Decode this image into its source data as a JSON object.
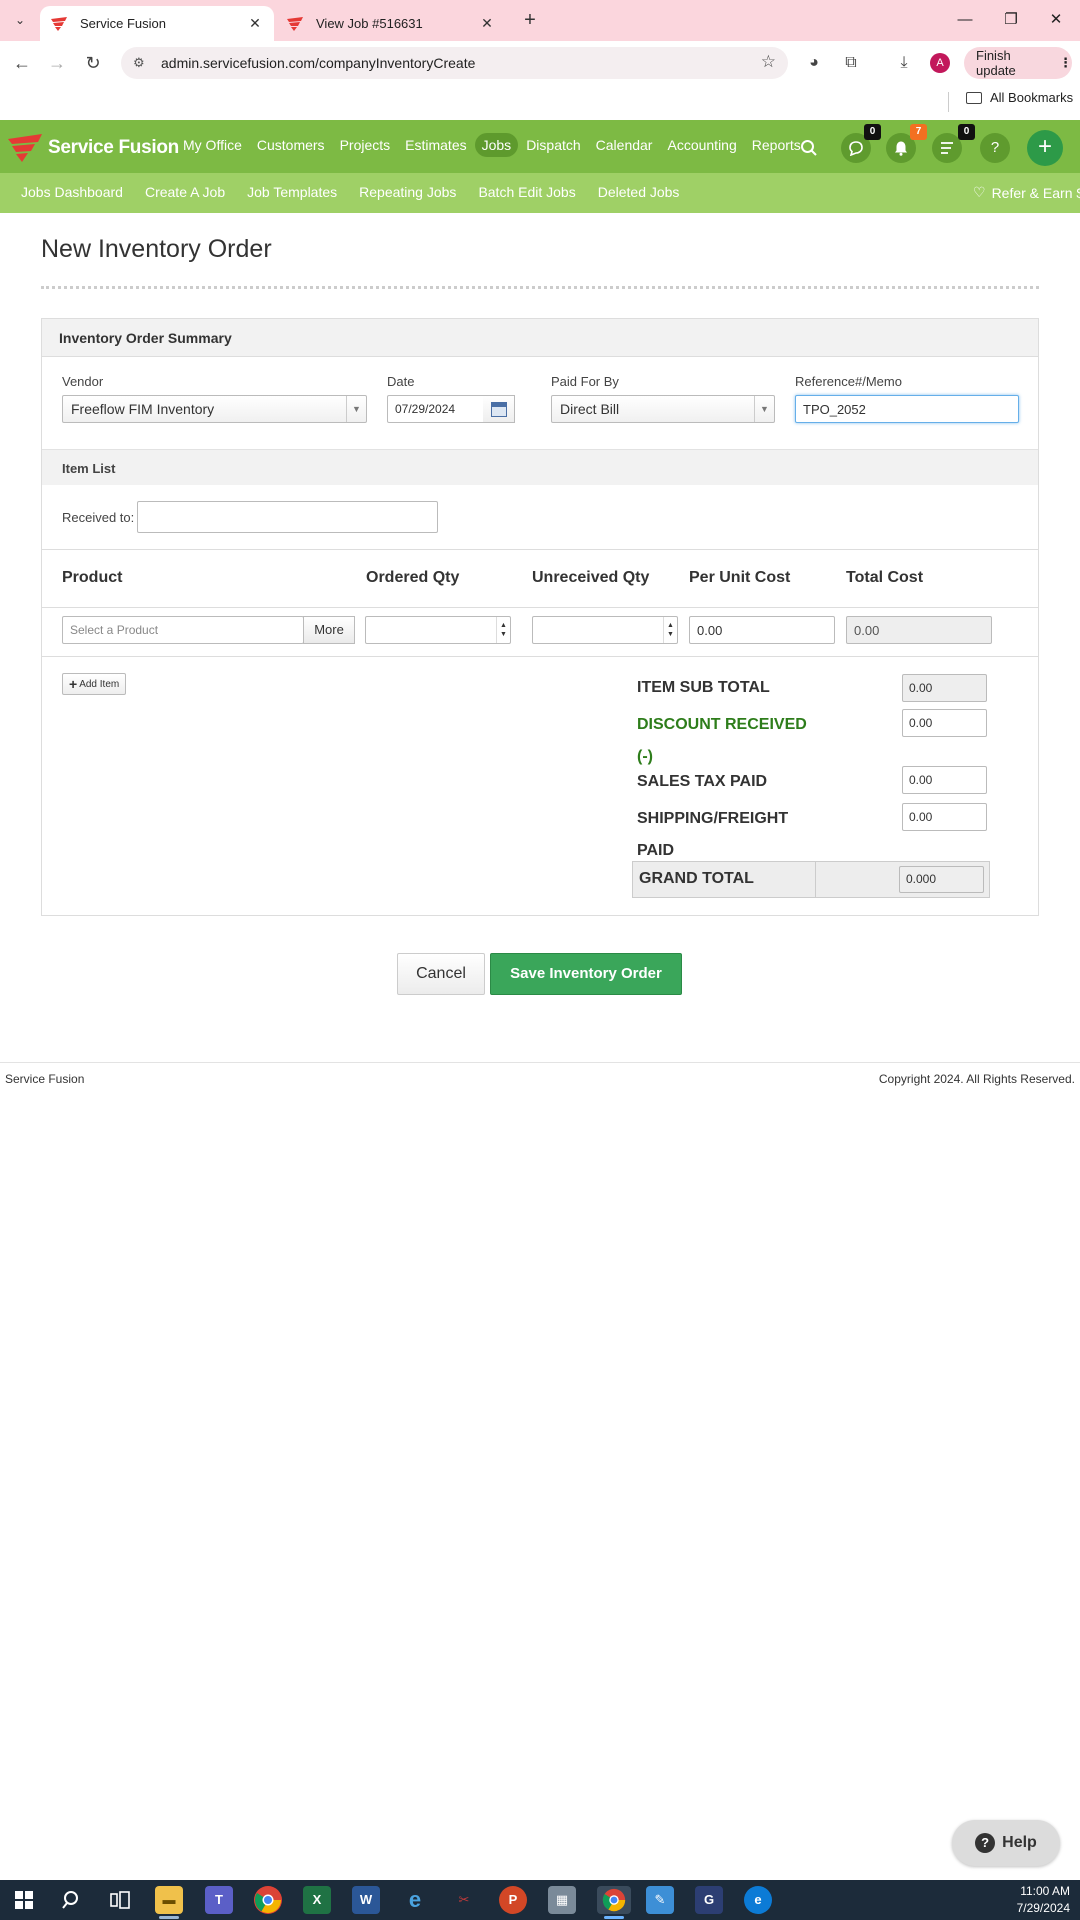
{
  "browser": {
    "tabs": [
      {
        "title": "Service Fusion",
        "active": true
      },
      {
        "title": "View Job #516631",
        "active": false
      }
    ],
    "url": "admin.servicefusion.com/companyInventoryCreate",
    "profile_initial": "A",
    "finish_update_label": "Finish update",
    "all_bookmarks_label": "All Bookmarks"
  },
  "app": {
    "brand": "Service Fusion",
    "main_nav": [
      "My Office",
      "Customers",
      "Projects",
      "Estimates",
      "Jobs",
      "Dispatch",
      "Calendar",
      "Accounting",
      "Reports"
    ],
    "active_nav": "Jobs",
    "badges": {
      "chat": "0",
      "notifications": "7",
      "tasks": "0"
    },
    "help_glyph": "?",
    "sub_nav": [
      "Jobs Dashboard",
      "Create A Job",
      "Job Templates",
      "Repeating Jobs",
      "Batch Edit Jobs",
      "Deleted Jobs"
    ],
    "refer_label": "Refer & Earn $",
    "colors": {
      "header_green": "#7dba44",
      "subnav_green": "#9fd066",
      "save_green": "#3aa65a",
      "discount_green": "#2e7d1b"
    }
  },
  "page": {
    "title": "New Inventory Order",
    "summary": {
      "heading": "Inventory Order Summary",
      "vendor_label": "Vendor",
      "vendor_value": "Freeflow FIM Inventory",
      "date_label": "Date",
      "date_value": "07/29/2024",
      "paid_for_by_label": "Paid For By",
      "paid_for_by_value": "Direct Bill",
      "reference_label": "Reference#/Memo",
      "reference_value": "TPO_2052"
    },
    "item_list": {
      "heading": "Item List",
      "received_to_label": "Received to:",
      "received_to_value": "",
      "columns": [
        "Product",
        "Ordered Qty",
        "Unreceived Qty",
        "Per Unit Cost",
        "Total Cost"
      ],
      "row": {
        "product_placeholder": "Select a Product",
        "more_label": "More",
        "ordered_qty": "",
        "unreceived_qty": "",
        "per_unit_cost": "0.00",
        "total_cost": "0.00"
      },
      "add_item_label": "Add Item"
    },
    "totals": {
      "item_sub_total_label": "ITEM SUB TOTAL",
      "item_sub_total": "0.00",
      "discount_label_line1": "DISCOUNT RECEIVED",
      "discount_label_line2": "(-)",
      "discount": "0.00",
      "sales_tax_label": "SALES TAX PAID",
      "sales_tax": "0.00",
      "shipping_label_line1": "SHIPPING/FREIGHT",
      "shipping_label_line2": "PAID",
      "shipping": "0.00",
      "grand_total_label": "GRAND TOTAL",
      "grand_total": "0.000"
    },
    "actions": {
      "cancel_label": "Cancel",
      "save_label": "Save Inventory Order"
    },
    "footer": {
      "left": "Service Fusion",
      "right": "Copyright 2024. All Rights Reserved."
    },
    "help_label": "Help"
  },
  "taskbar": {
    "time": "11:00 AM",
    "date": "7/29/2024"
  }
}
